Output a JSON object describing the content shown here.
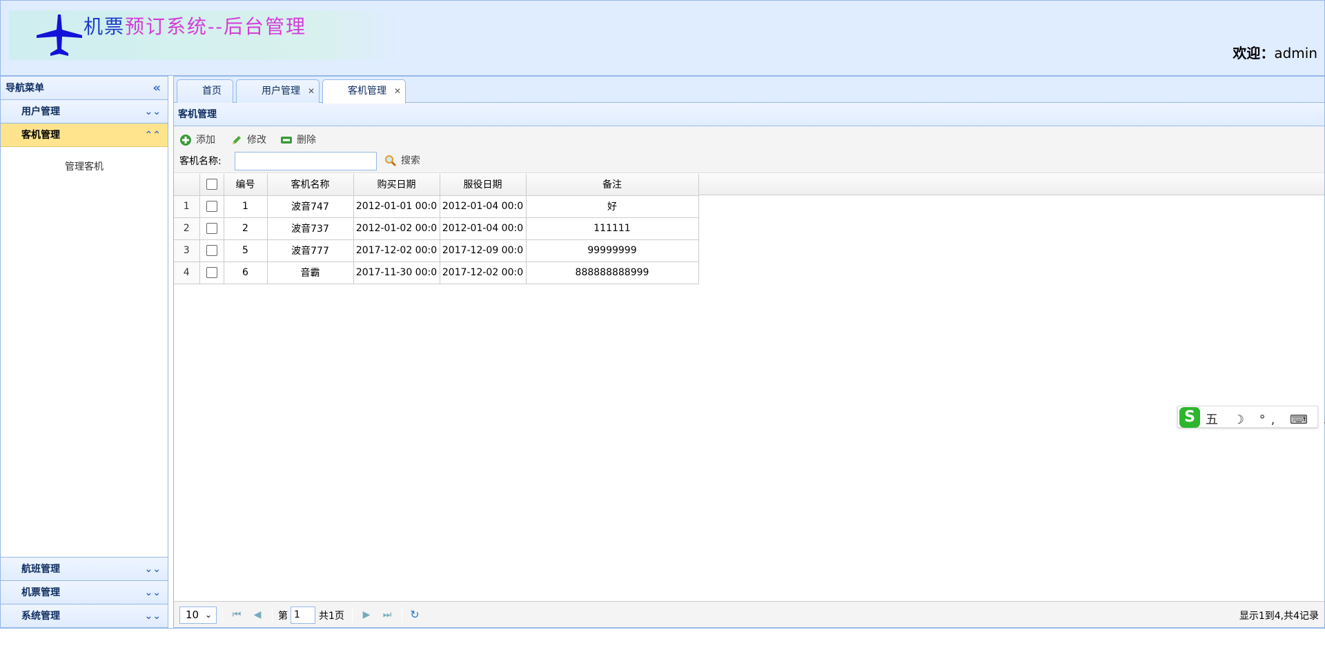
{
  "header": {
    "title_part1": "机票",
    "title_part2": "预订系统",
    "title_part3": "--",
    "title_part4": "后台管理",
    "welcome_label": "欢迎：",
    "welcome_user": "admin"
  },
  "sidebar": {
    "title": "导航菜单",
    "groups": [
      {
        "label": "用户管理",
        "expanded": false
      },
      {
        "label": "客机管理",
        "expanded": true,
        "items": [
          "管理客机"
        ]
      },
      {
        "label": "航班管理",
        "expanded": false
      },
      {
        "label": "机票管理",
        "expanded": false
      },
      {
        "label": "系统管理",
        "expanded": false
      }
    ]
  },
  "tabs": [
    {
      "label": "首页",
      "closable": false
    },
    {
      "label": "用户管理",
      "closable": true
    },
    {
      "label": "客机管理",
      "closable": true,
      "active": true
    }
  ],
  "panel": {
    "title": "客机管理",
    "toolbar": {
      "add": "添加",
      "edit": "修改",
      "delete": "删除",
      "search_label": "客机名称:",
      "search_value": "",
      "search_button": "搜索"
    },
    "grid": {
      "columns": [
        "编号",
        "客机名称",
        "购买日期",
        "服役日期",
        "备注"
      ],
      "rows": [
        {
          "rownum": "1",
          "id": "1",
          "name": "波音747",
          "buy_date": "2012-01-01 00:0",
          "service_date": "2012-01-04 00:0",
          "remark": "好"
        },
        {
          "rownum": "2",
          "id": "2",
          "name": "波音737",
          "buy_date": "2012-01-02 00:0",
          "service_date": "2012-01-04 00:0",
          "remark": "111111"
        },
        {
          "rownum": "3",
          "id": "5",
          "name": "波音777",
          "buy_date": "2017-12-02 00:0",
          "service_date": "2017-12-09 00:0",
          "remark": "99999999"
        },
        {
          "rownum": "4",
          "id": "6",
          "name": "音霸",
          "buy_date": "2017-11-30 00:0",
          "service_date": "2017-12-02 00:0",
          "remark": "888888888999"
        }
      ]
    },
    "pager": {
      "page_size": "10",
      "page_prefix": "第",
      "page_value": "1",
      "page_suffix": "共1页",
      "info": "显示1到4,共4记录"
    }
  },
  "ime": {
    "logo": "S",
    "items": "五 ☽ °, ⌨ ♟ ✤"
  },
  "colors": {
    "header_bg": "#e0ecff",
    "border": "#95b8e7",
    "active_group": "#ffe48d",
    "title_blue": "#1a3cc8",
    "title_magenta": "#d43cd8"
  }
}
